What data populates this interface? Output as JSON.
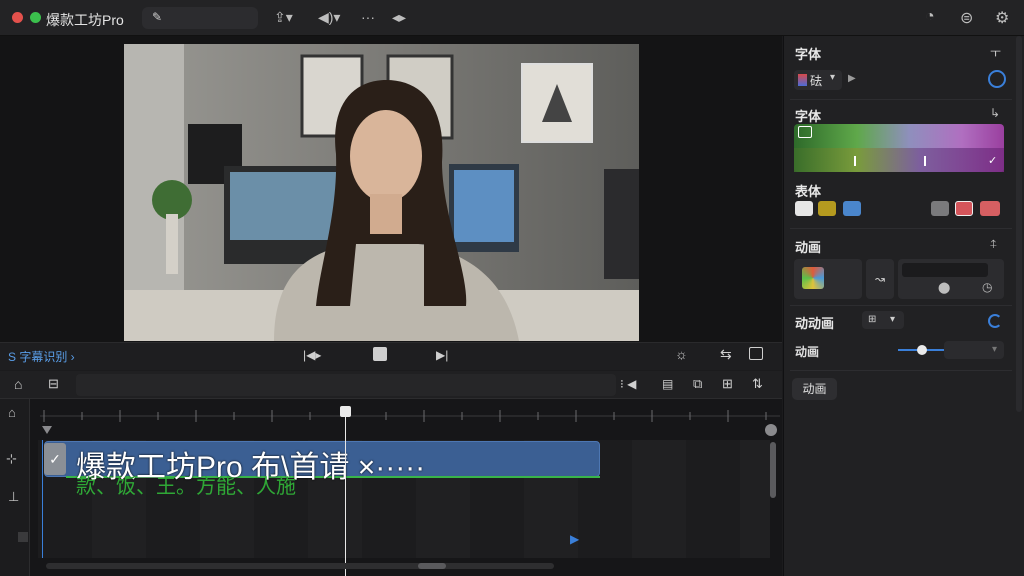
{
  "app": {
    "title": "爆款工坊Pro"
  },
  "breadcrumb": {
    "label": "S 字幕识别 ›"
  },
  "timeline": {
    "clip_title": "爆款工坊Pro 布\\首请 ×·····",
    "subtitle_line": "款、饭、王。方能、人施"
  },
  "panel": {
    "font_title": "字体",
    "font_dropdown": "砝",
    "font_style_title": "字体",
    "color_title": "表体",
    "animation_title": "动画",
    "motion_title": "动动画",
    "motion_label": "动画",
    "animation_button": "动画",
    "swatch_colors": [
      "#e6e6e6",
      "#b59a1f",
      "#4a86cc",
      "#7a7a7c",
      "#d4555b",
      "#d65f62"
    ],
    "accent_color": "#3a7fd9"
  }
}
